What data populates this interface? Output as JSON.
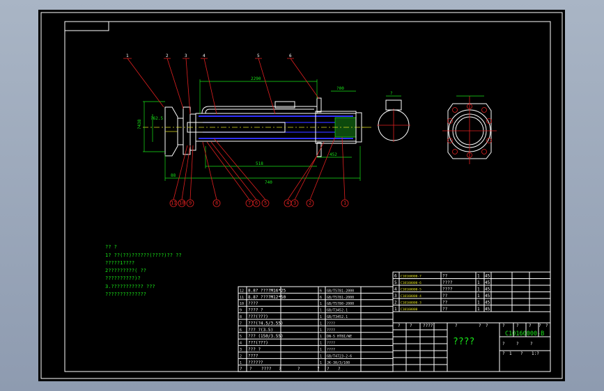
{
  "drawing": {
    "title_text": "????",
    "drawing_number": "C10160000-B",
    "approval_row": [
      "?",
      "?",
      "?",
      "?",
      "?",
      "?",
      "?"
    ],
    "scale_header": [
      "?",
      "?",
      "?"
    ],
    "scale_values": [
      "?",
      "1",
      "?",
      "1:?"
    ],
    "header_sign_row": [
      "?",
      "?",
      "????",
      "?"
    ],
    "tech_notes": [
      "?? ?",
      "1? ??(??)??????(????)?? ??",
      "?????1????",
      "2?????????( ??",
      "??????????)?",
      "3.??????????? ???",
      "??????????????"
    ],
    "dims": {
      "top_length": "2290",
      "left_dia": "?62.5",
      "left_height": "?438",
      "right_top": "?00",
      "bottom_1": "88",
      "bottom_2": "740",
      "bottom_3": "518",
      "bottom_4": "452",
      "top_right_small": "?"
    },
    "top_callouts": [
      "1",
      "2",
      "3",
      "4",
      "5",
      "6"
    ],
    "bottom_callouts": [
      "11",
      "10",
      "9",
      "8",
      "7",
      "6",
      "5",
      "4",
      "3",
      "2",
      "1"
    ],
    "bom_rows": [
      {
        "no": "12",
        "code": "?",
        "name": "8.8?  ????M16*25",
        "qty": "6",
        "std": "GB/T5781-2000",
        "note": ""
      },
      {
        "no": "11",
        "code": "?",
        "name": "8.8?  ????M12*50",
        "qty": "6",
        "std": "GB/T5781-2000",
        "note": ""
      },
      {
        "no": "10",
        "code": "?",
        "name": "????",
        "qty": "1",
        "std": "GB/T5780-2000",
        "note": ""
      },
      {
        "no": "9",
        "code": "?",
        "name": "???? ?",
        "qty": "1",
        "std": "GB/T3452.1",
        "note": ""
      },
      {
        "no": "8",
        "code": "?",
        "name": "???(???)",
        "qty": "1",
        "std": "GB/T3452.1",
        "note": ""
      },
      {
        "no": "7",
        "code": "?",
        "name": "???(?4.5/3.55)",
        "qty": "1",
        "std": "????",
        "note": ""
      },
      {
        "no": "6",
        "code": "?",
        "name": "??? ?(3.5)",
        "qty": "1",
        "std": "????",
        "note": ""
      },
      {
        "no": "5",
        "code": "?",
        "name": "??? (150/3.55)",
        "qty": "1",
        "std": "DN-5 HTBI/WE",
        "note": ""
      },
      {
        "no": "4",
        "code": "?",
        "name": "???(???)",
        "qty": "1",
        "std": "????",
        "note": ""
      },
      {
        "no": "3",
        "code": "?",
        "name": "??? ?",
        "qty": "1",
        "std": "????",
        "note": ""
      },
      {
        "no": "2",
        "code": "?",
        "name": "????",
        "qty": "1",
        "std": "GB/T4723-2-6",
        "note": ""
      },
      {
        "no": "1",
        "code": "?",
        "name": "??????",
        "qty": "1",
        "std": "JK-30/3/100",
        "note": ""
      }
    ],
    "bom_header": [
      "?",
      "?",
      "????",
      "?",
      "?",
      "?",
      "?",
      "?"
    ],
    "part_rows": [
      {
        "no": "6",
        "code": "C10160000-7",
        "name": "??",
        "qty": "1",
        "mat": "45"
      },
      {
        "no": "5",
        "code": "C10160000-6",
        "name": "????",
        "qty": "1",
        "mat": "45"
      },
      {
        "no": "4",
        "code": "C10160000-5",
        "name": "????",
        "qty": "1",
        "mat": "45"
      },
      {
        "no": "3",
        "code": "C10160000-4",
        "name": "??",
        "qty": "1",
        "mat": "45"
      },
      {
        "no": "2",
        "code": "C10160000-3",
        "name": "??",
        "qty": "1",
        "mat": "45"
      },
      {
        "no": "1",
        "code": "C10160000",
        "name": "??",
        "qty": "1",
        "mat": "45"
      }
    ]
  }
}
